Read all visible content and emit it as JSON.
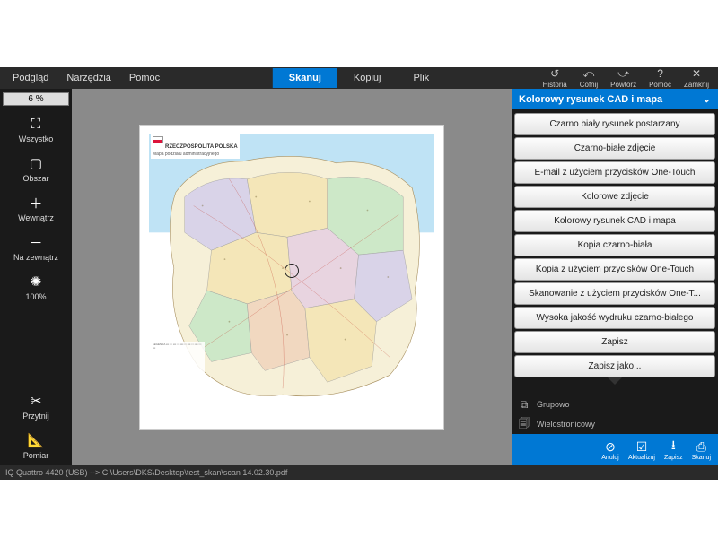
{
  "menu": {
    "left": [
      "Podgląd",
      "Narzędzia",
      "Pomoc"
    ],
    "center": {
      "scan": "Skanuj",
      "copy": "Kopiuj",
      "file": "Plik"
    },
    "right": {
      "history": "Historia",
      "undo": "Cofnij",
      "redo": "Powtórz",
      "help": "Pomoc",
      "close": "Zamknij"
    }
  },
  "sidebar": {
    "zoom": "6 %",
    "tools": {
      "all": "Wszystko",
      "area": "Obszar",
      "inside": "Wewnątrz",
      "outside": "Na zewnątrz",
      "pct100": "100%"
    },
    "bottom": {
      "crop": "Przytnij",
      "measure": "Pomiar"
    }
  },
  "document": {
    "title": "RZECZPOSPOLITA POLSKA",
    "subtitle": "Mapa podziału administracyjnego"
  },
  "presets": {
    "header": "Kolorowy rysunek CAD i mapa",
    "items": [
      "Czarno biały rysunek postarzany",
      "Czarno-białe zdjęcie",
      "E-mail z użyciem przycisków One-Touch",
      "Kolorowe zdjęcie",
      "Kolorowy rysunek CAD i mapa",
      "Kopia czarno-biała",
      "Kopia z użyciem przycisków One-Touch",
      "Skanowanie z użyciem przycisków One-T...",
      "Wysoka jakość wydruku czarno-białego",
      "Zapisz",
      "Zapisz jako..."
    ]
  },
  "options": {
    "group": "Grupowo",
    "multipage": "Wielostronicowy"
  },
  "actions": {
    "cancel": "Anuluj",
    "update": "Aktualizuj",
    "save": "Zapisz",
    "scan": "Skanuj"
  },
  "status": "IQ Quattro 4420 (USB)  -->  C:\\Users\\DKS\\Desktop\\test_skan\\scan 14.02.30.pdf"
}
